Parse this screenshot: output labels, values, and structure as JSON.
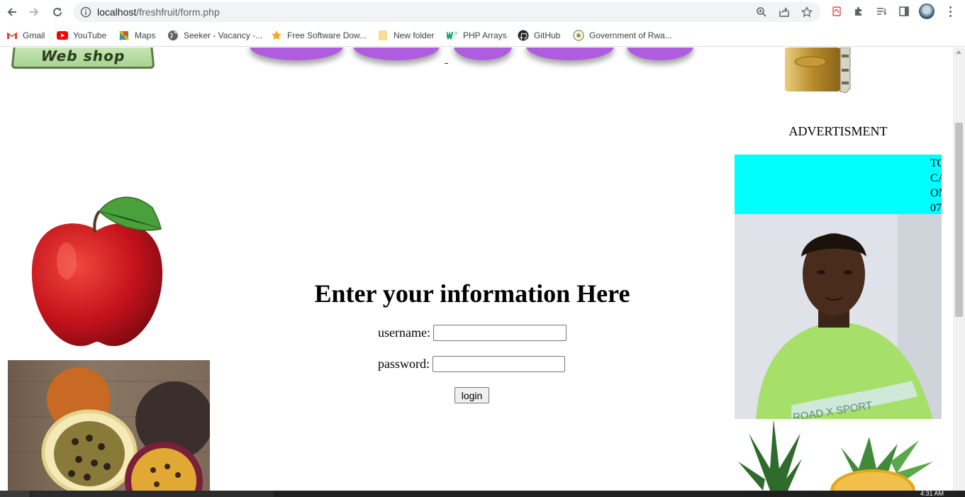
{
  "browser": {
    "url_host": "localhost",
    "url_path": "/freshfruit/form.php",
    "bookmarks": [
      {
        "label": "Gmail",
        "icon": "gmail-icon"
      },
      {
        "label": "YouTube",
        "icon": "youtube-icon"
      },
      {
        "label": "Maps",
        "icon": "maps-icon"
      },
      {
        "label": "Seeker - Vacancy -...",
        "icon": "globe-icon"
      },
      {
        "label": "Free Software Dow...",
        "icon": "star-icon"
      },
      {
        "label": "New folder",
        "icon": "folder-icon"
      },
      {
        "label": "PHP Arrays",
        "icon": "w3schools-icon"
      },
      {
        "label": "GitHub",
        "icon": "github-icon"
      },
      {
        "label": "Government of Rwa...",
        "icon": "rwanda-seal-icon"
      }
    ]
  },
  "page": {
    "logo_text": "Web shop",
    "advert": {
      "title": "ADVERTISMENT",
      "lines": [
        "TO",
        "CA",
        "ON",
        "07"
      ],
      "box_color": "#00ffff"
    },
    "form": {
      "title": "Enter your information Here",
      "username_label": "username:",
      "username_value": "",
      "password_label": "password:",
      "password_value": "",
      "login_label": "login"
    },
    "person_shirt_text": "ROAD X SPORT",
    "menu_color": "#b05ce0"
  },
  "taskbar": {
    "clock": "4:31 AM"
  }
}
